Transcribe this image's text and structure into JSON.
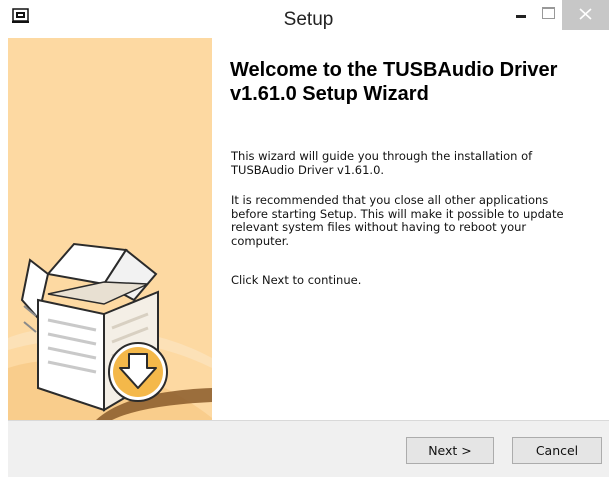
{
  "window": {
    "title": "Setup"
  },
  "welcome": {
    "title_line1": "Welcome to the TUSBAudio Driver",
    "title_line2": "v1.61.0 Setup Wizard",
    "para1_line1": "This wizard will guide you through the installation of",
    "para1_line2": "TUSBAudio Driver v1.61.0.",
    "para2_line1": "It is recommended that you close all other applications",
    "para2_line2": "before starting Setup. This will make it possible to update",
    "para2_line3": "relevant system files without having to reboot your",
    "para2_line4": "computer.",
    "para3": "Click Next to continue."
  },
  "buttons": {
    "next": "Next >",
    "cancel": "Cancel"
  },
  "colors": {
    "side_panel": "#fdd9a2",
    "close_button": "#c7c7c7",
    "download_arrow": "#f4b84a"
  },
  "icons": {
    "app": "installer-app-icon",
    "side_art": "box-download-illustration"
  }
}
